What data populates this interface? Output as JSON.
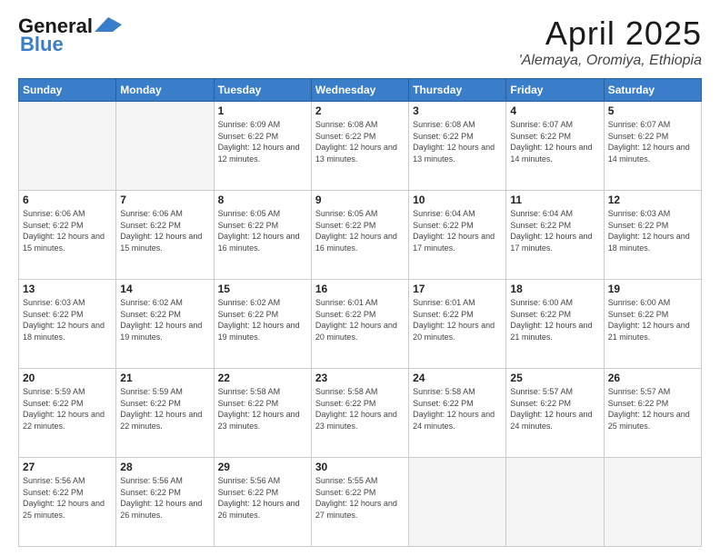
{
  "header": {
    "logo_line1": "General",
    "logo_line2": "Blue",
    "month": "April 2025",
    "location": "'Alemaya, Oromiya, Ethiopia"
  },
  "weekdays": [
    "Sunday",
    "Monday",
    "Tuesday",
    "Wednesday",
    "Thursday",
    "Friday",
    "Saturday"
  ],
  "weeks": [
    [
      {
        "day": null
      },
      {
        "day": null
      },
      {
        "day": "1",
        "sunrise": "6:09 AM",
        "sunset": "6:22 PM",
        "daylight": "12 hours and 12 minutes."
      },
      {
        "day": "2",
        "sunrise": "6:08 AM",
        "sunset": "6:22 PM",
        "daylight": "12 hours and 13 minutes."
      },
      {
        "day": "3",
        "sunrise": "6:08 AM",
        "sunset": "6:22 PM",
        "daylight": "12 hours and 13 minutes."
      },
      {
        "day": "4",
        "sunrise": "6:07 AM",
        "sunset": "6:22 PM",
        "daylight": "12 hours and 14 minutes."
      },
      {
        "day": "5",
        "sunrise": "6:07 AM",
        "sunset": "6:22 PM",
        "daylight": "12 hours and 14 minutes."
      }
    ],
    [
      {
        "day": "6",
        "sunrise": "6:06 AM",
        "sunset": "6:22 PM",
        "daylight": "12 hours and 15 minutes."
      },
      {
        "day": "7",
        "sunrise": "6:06 AM",
        "sunset": "6:22 PM",
        "daylight": "12 hours and 15 minutes."
      },
      {
        "day": "8",
        "sunrise": "6:05 AM",
        "sunset": "6:22 PM",
        "daylight": "12 hours and 16 minutes."
      },
      {
        "day": "9",
        "sunrise": "6:05 AM",
        "sunset": "6:22 PM",
        "daylight": "12 hours and 16 minutes."
      },
      {
        "day": "10",
        "sunrise": "6:04 AM",
        "sunset": "6:22 PM",
        "daylight": "12 hours and 17 minutes."
      },
      {
        "day": "11",
        "sunrise": "6:04 AM",
        "sunset": "6:22 PM",
        "daylight": "12 hours and 17 minutes."
      },
      {
        "day": "12",
        "sunrise": "6:03 AM",
        "sunset": "6:22 PM",
        "daylight": "12 hours and 18 minutes."
      }
    ],
    [
      {
        "day": "13",
        "sunrise": "6:03 AM",
        "sunset": "6:22 PM",
        "daylight": "12 hours and 18 minutes."
      },
      {
        "day": "14",
        "sunrise": "6:02 AM",
        "sunset": "6:22 PM",
        "daylight": "12 hours and 19 minutes."
      },
      {
        "day": "15",
        "sunrise": "6:02 AM",
        "sunset": "6:22 PM",
        "daylight": "12 hours and 19 minutes."
      },
      {
        "day": "16",
        "sunrise": "6:01 AM",
        "sunset": "6:22 PM",
        "daylight": "12 hours and 20 minutes."
      },
      {
        "day": "17",
        "sunrise": "6:01 AM",
        "sunset": "6:22 PM",
        "daylight": "12 hours and 20 minutes."
      },
      {
        "day": "18",
        "sunrise": "6:00 AM",
        "sunset": "6:22 PM",
        "daylight": "12 hours and 21 minutes."
      },
      {
        "day": "19",
        "sunrise": "6:00 AM",
        "sunset": "6:22 PM",
        "daylight": "12 hours and 21 minutes."
      }
    ],
    [
      {
        "day": "20",
        "sunrise": "5:59 AM",
        "sunset": "6:22 PM",
        "daylight": "12 hours and 22 minutes."
      },
      {
        "day": "21",
        "sunrise": "5:59 AM",
        "sunset": "6:22 PM",
        "daylight": "12 hours and 22 minutes."
      },
      {
        "day": "22",
        "sunrise": "5:58 AM",
        "sunset": "6:22 PM",
        "daylight": "12 hours and 23 minutes."
      },
      {
        "day": "23",
        "sunrise": "5:58 AM",
        "sunset": "6:22 PM",
        "daylight": "12 hours and 23 minutes."
      },
      {
        "day": "24",
        "sunrise": "5:58 AM",
        "sunset": "6:22 PM",
        "daylight": "12 hours and 24 minutes."
      },
      {
        "day": "25",
        "sunrise": "5:57 AM",
        "sunset": "6:22 PM",
        "daylight": "12 hours and 24 minutes."
      },
      {
        "day": "26",
        "sunrise": "5:57 AM",
        "sunset": "6:22 PM",
        "daylight": "12 hours and 25 minutes."
      }
    ],
    [
      {
        "day": "27",
        "sunrise": "5:56 AM",
        "sunset": "6:22 PM",
        "daylight": "12 hours and 25 minutes."
      },
      {
        "day": "28",
        "sunrise": "5:56 AM",
        "sunset": "6:22 PM",
        "daylight": "12 hours and 26 minutes."
      },
      {
        "day": "29",
        "sunrise": "5:56 AM",
        "sunset": "6:22 PM",
        "daylight": "12 hours and 26 minutes."
      },
      {
        "day": "30",
        "sunrise": "5:55 AM",
        "sunset": "6:22 PM",
        "daylight": "12 hours and 27 minutes."
      },
      {
        "day": null
      },
      {
        "day": null
      },
      {
        "day": null
      }
    ]
  ],
  "labels": {
    "sunrise_prefix": "Sunrise: ",
    "sunset_prefix": "Sunset: ",
    "daylight_prefix": "Daylight: "
  }
}
